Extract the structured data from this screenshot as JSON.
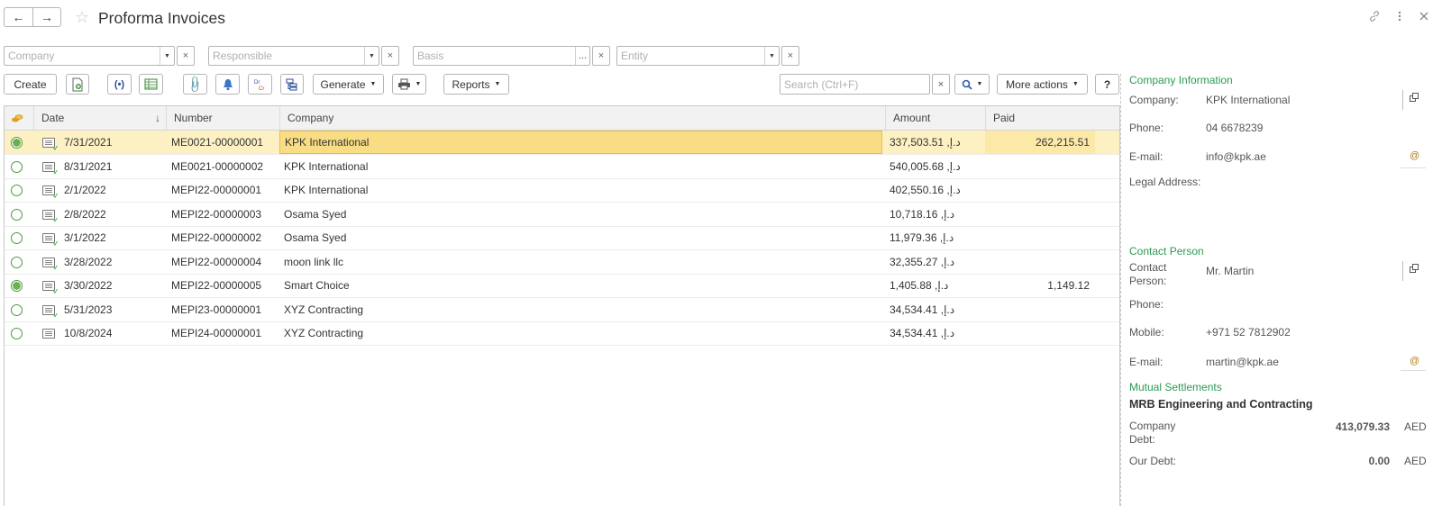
{
  "window": {
    "title": "Proforma Invoices",
    "back_icon": "←",
    "forward_icon": "→",
    "star_icon": "☆"
  },
  "filters": [
    {
      "placeholder": "Company",
      "has_dropdown": true
    },
    {
      "placeholder": "Responsible",
      "has_dropdown": true
    },
    {
      "placeholder": "Basis",
      "has_dropdown": false
    },
    {
      "placeholder": "Entity",
      "has_dropdown": true
    }
  ],
  "toolbar": {
    "create_label": "Create",
    "generate_label": "Generate",
    "reports_label": "Reports",
    "more_actions_label": "More actions",
    "help_label": "?",
    "search_placeholder": "Search (Ctrl+F)",
    "search_clear": "×",
    "dropdown_glyph": "▾"
  },
  "table": {
    "columns": [
      "Date",
      "Number",
      "Company",
      "Amount",
      "Paid"
    ],
    "sort_glyph": "↓",
    "rows": [
      {
        "date": "7/31/2021",
        "number": "ME0021-00000001",
        "company": "KPK International",
        "amount": "337,503.51 ,د.إ",
        "paid": "262,215.51",
        "status": "paid",
        "posted": true,
        "selected": true
      },
      {
        "date": "8/31/2021",
        "number": "ME0021-00000002",
        "company": "KPK International",
        "amount": "540,005.68 ,د.إ",
        "paid": "",
        "status": "open",
        "posted": true,
        "selected": false
      },
      {
        "date": "2/1/2022",
        "number": "MEPI22-00000001",
        "company": "KPK International",
        "amount": "402,550.16 ,د.إ",
        "paid": "",
        "status": "open",
        "posted": true,
        "selected": false
      },
      {
        "date": "2/8/2022",
        "number": "MEPI22-00000003",
        "company": "Osama Syed",
        "amount": "10,718.16 ,د.إ",
        "paid": "",
        "status": "open",
        "posted": true,
        "selected": false
      },
      {
        "date": "3/1/2022",
        "number": "MEPI22-00000002",
        "company": "Osama Syed",
        "amount": "11,979.36 ,د.إ",
        "paid": "",
        "status": "open",
        "posted": true,
        "selected": false
      },
      {
        "date": "3/28/2022",
        "number": "MEPI22-00000004",
        "company": "moon link llc",
        "amount": "32,355.27 ,د.إ",
        "paid": "",
        "status": "open",
        "posted": true,
        "selected": false
      },
      {
        "date": "3/30/2022",
        "number": "MEPI22-00000005",
        "company": "Smart Choice",
        "amount": "1,405.88 ,د.إ",
        "paid": "1,149.12",
        "status": "paid",
        "posted": true,
        "selected": false
      },
      {
        "date": "5/31/2023",
        "number": "MEPI23-00000001",
        "company": "XYZ Contracting",
        "amount": "34,534.41 ,د.إ",
        "paid": "",
        "status": "open",
        "posted": true,
        "selected": false
      },
      {
        "date": "10/8/2024",
        "number": "MEPI24-00000001",
        "company": "XYZ Contracting",
        "amount": "34,534.41 ,د.إ",
        "paid": "",
        "status": "open",
        "posted": false,
        "selected": false
      }
    ]
  },
  "panel": {
    "company_info_title": "Company Information",
    "company_label": "Company:",
    "company_value": "KPK International",
    "phone_label": "Phone:",
    "phone_value": "04 6678239",
    "email_label": "E-mail:",
    "email_value": "info@kpk.ae",
    "legal_address_label": "Legal Address:",
    "contact_title": "Contact Person",
    "contact_label_1": "Contact",
    "contact_label_2": "Person:",
    "contact_value": "Mr. Martin",
    "contact_phone_label": "Phone:",
    "mobile_label": "Mobile:",
    "mobile_value": "+971 52 7812902",
    "contact_email_label": "E-mail:",
    "contact_email_value": "martin@kpk.ae",
    "settlements_title": "Mutual Settlements",
    "settlements_company": "MRB Engineering and Contracting",
    "company_debt_label_1": "Company",
    "company_debt_label_2": "Debt:",
    "company_debt_value": "413,079.33",
    "company_debt_currency": "AED",
    "our_debt_label": "Our Debt:",
    "our_debt_value": "0.00",
    "our_debt_currency": "AED"
  }
}
